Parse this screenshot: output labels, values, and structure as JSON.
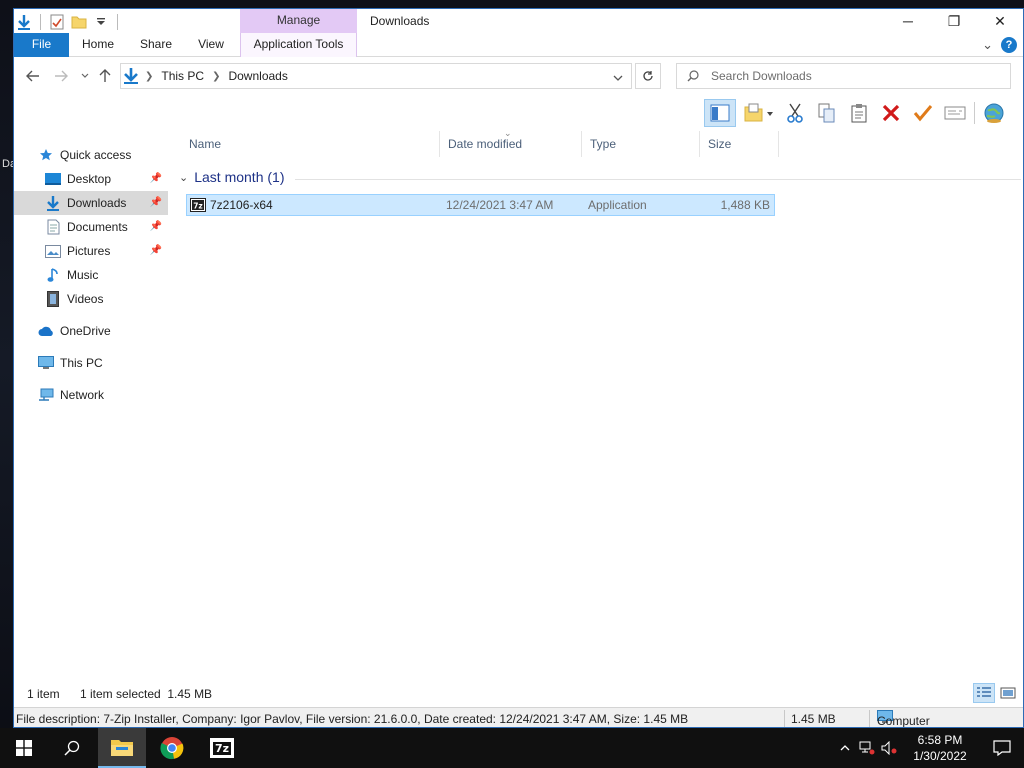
{
  "desktop": {
    "partial_label": "Da"
  },
  "titlebar": {
    "context_tab_header": "Manage",
    "title": "Downloads",
    "minimize_glyph": "─",
    "maximize_glyph": "❐",
    "close_glyph": "✕"
  },
  "ribbon": {
    "tabs": [
      "File",
      "Home",
      "Share",
      "View",
      "Application Tools"
    ],
    "expand_glyph": "⌄",
    "help_glyph": "?"
  },
  "address": {
    "breadcrumbs": [
      "This PC",
      "Downloads"
    ],
    "search_placeholder": "Search Downloads"
  },
  "nav_pane": {
    "items": [
      {
        "label": "Quick access",
        "icon": "star-icon",
        "pinned": false
      },
      {
        "label": "Desktop",
        "icon": "desktop-folder-icon",
        "pinned": true
      },
      {
        "label": "Downloads",
        "icon": "download-arrow-icon",
        "pinned": true,
        "selected": true
      },
      {
        "label": "Documents",
        "icon": "documents-icon",
        "pinned": true
      },
      {
        "label": "Pictures",
        "icon": "pictures-icon",
        "pinned": true
      },
      {
        "label": "Music",
        "icon": "music-note-icon",
        "pinned": false
      },
      {
        "label": "Videos",
        "icon": "videos-icon",
        "pinned": false
      },
      {
        "label": "OneDrive",
        "icon": "cloud-icon",
        "pinned": false
      },
      {
        "label": "This PC",
        "icon": "computer-icon",
        "pinned": false
      },
      {
        "label": "Network",
        "icon": "network-icon",
        "pinned": false
      }
    ]
  },
  "file_list": {
    "columns": [
      "Name",
      "Date modified",
      "Type",
      "Size"
    ],
    "group_label": "Last month (1)",
    "rows": [
      {
        "name": "7z2106-x64",
        "date_modified": "12/24/2021 3:47 AM",
        "type": "Application",
        "size": "1,488 KB",
        "selected": true
      }
    ]
  },
  "status_bar": {
    "item_count": "1 item",
    "selection": "1 item selected  1.45 MB"
  },
  "info_bar": {
    "description": "File description: 7-Zip Installer, Company: Igor Pavlov, File version: 21.6.0.0, Date created: 12/24/2021 3:47 AM, Size: 1.45 MB",
    "size": "1.45 MB",
    "location": "Computer"
  },
  "taskbar": {
    "apps": [
      "start",
      "search",
      "file-explorer",
      "chrome",
      "7zip"
    ],
    "clock_time": "6:58 PM",
    "clock_date": "1/30/2022",
    "seven_zip_label": "7z"
  },
  "colors": {
    "accent": "#1979ca",
    "selection": "#cce8ff",
    "context_tab": "#e3c9f5",
    "group_header": "#1e3287"
  }
}
